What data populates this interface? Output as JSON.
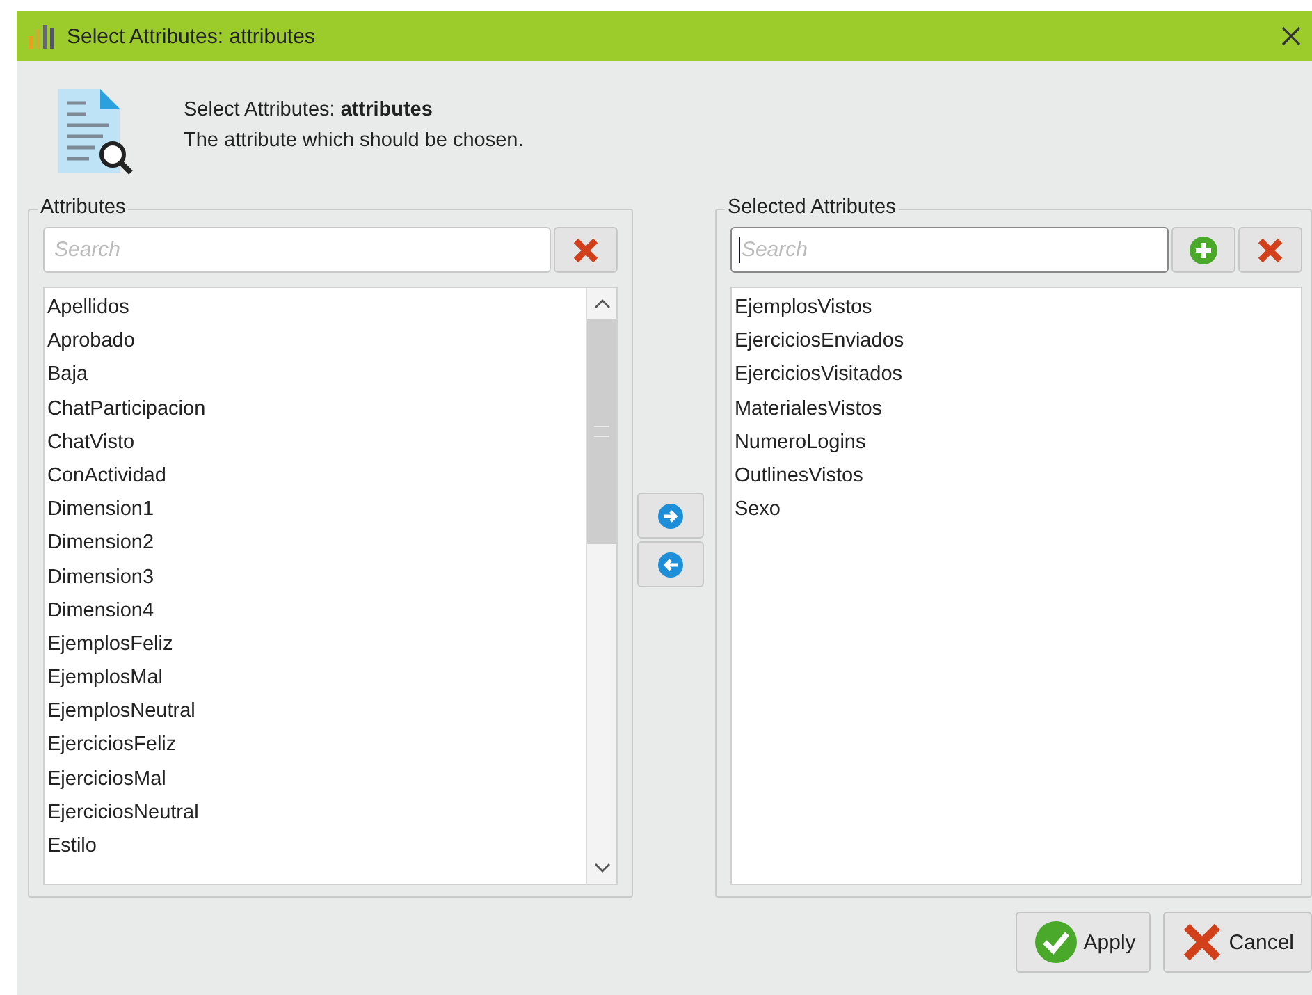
{
  "window": {
    "title": "Select Attributes: attributes"
  },
  "header": {
    "title": "Select Attributes: **attributes**",
    "subtitle": "The attribute which should be chosen."
  },
  "available": {
    "label": "Attributes",
    "search": {
      "placeholder": "Search",
      "focused": false
    },
    "items": [
      "Apellidos",
      "Aprobado",
      "Baja",
      "ChatParticipacion",
      "ChatVisto",
      "ConActividad",
      "Dimension1",
      "Dimension2",
      "Dimension3",
      "Dimension4",
      "EjemplosFeliz",
      "EjemplosMal",
      "EjemplosNeutral",
      "EjerciciosFeliz",
      "EjerciciosMal",
      "EjerciciosNeutral",
      "Estilo"
    ]
  },
  "selected_attributes": {
    "label": "Selected Attributes",
    "search": {
      "placeholder": "Search",
      "focused": true
    },
    "items": [
      "EjemplosVistos",
      "EjerciciosEnviados",
      "EjerciciosVisitados",
      "MaterialesVistos",
      "NumeroLogins",
      "OutlinesVistos",
      "Sexo"
    ]
  },
  "buttons": [
    {
      "label": "Apply",
      "kind": "apply"
    },
    {
      "label": "Cancel",
      "kind": "cancel"
    }
  ]
}
